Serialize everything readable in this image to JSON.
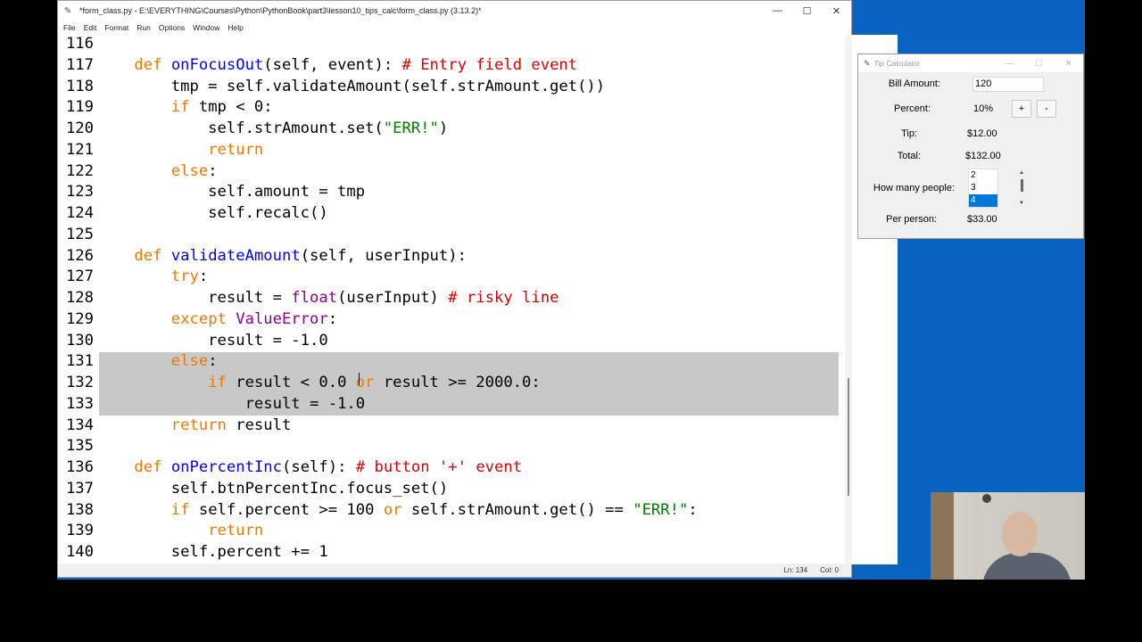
{
  "editor": {
    "title": "*form_class.py - E:\\EVERYTHING\\Courses\\Python\\PythonBook\\part3\\lesson10_tips_calc\\form_class.py (3.13.2)*",
    "menu": [
      "File",
      "Edit",
      "Format",
      "Run",
      "Options",
      "Window",
      "Help"
    ],
    "status_line": "Ln: 134",
    "status_col": "Col: 0"
  },
  "code_lines": [
    {
      "n": "116",
      "t": ""
    },
    {
      "n": "117",
      "t": "    def onFocusOut(self, event): # Entry field event"
    },
    {
      "n": "118",
      "t": "        tmp = self.validateAmount(self.strAmount.get())"
    },
    {
      "n": "119",
      "t": "        if tmp < 0:"
    },
    {
      "n": "120",
      "t": "            self.strAmount.set(\"ERR!\")"
    },
    {
      "n": "121",
      "t": "            return"
    },
    {
      "n": "122",
      "t": "        else:"
    },
    {
      "n": "123",
      "t": "            self.amount = tmp"
    },
    {
      "n": "124",
      "t": "            self.recalc()"
    },
    {
      "n": "125",
      "t": ""
    },
    {
      "n": "126",
      "t": "    def validateAmount(self, userInput):"
    },
    {
      "n": "127",
      "t": "        try:"
    },
    {
      "n": "128",
      "t": "            result = float(userInput) # risky line"
    },
    {
      "n": "129",
      "t": "        except ValueError:"
    },
    {
      "n": "130",
      "t": "            result = -1.0"
    },
    {
      "n": "131",
      "t": "        else:"
    },
    {
      "n": "132",
      "t": "            if result < 0.0 or result >= 2000.0:"
    },
    {
      "n": "133",
      "t": "                result = -1.0"
    },
    {
      "n": "134",
      "t": "        return result"
    },
    {
      "n": "135",
      "t": ""
    },
    {
      "n": "136",
      "t": "    def onPercentInc(self): # button '+' event"
    },
    {
      "n": "137",
      "t": "        self.btnPercentInc.focus_set()"
    },
    {
      "n": "138",
      "t": "        if self.percent >= 100 or self.strAmount.get() == \"ERR!\":"
    },
    {
      "n": "139",
      "t": "            return"
    },
    {
      "n": "140",
      "t": "        self.percent += 1"
    }
  ],
  "tipcalc": {
    "title": "Tip Calculator",
    "bill_label": "Bill Amount:",
    "bill_value": "120",
    "percent_label": "Percent:",
    "percent_value": "10%",
    "plus": "+",
    "minus": "-",
    "tip_label": "Tip:",
    "tip_value": "$12.00",
    "total_label": "Total:",
    "total_value": "$132.00",
    "people_label": "How many people:",
    "people_options": [
      "2",
      "3",
      "4"
    ],
    "people_selected": "4",
    "per_person_label": "Per person:",
    "per_person_value": "$33.00"
  }
}
